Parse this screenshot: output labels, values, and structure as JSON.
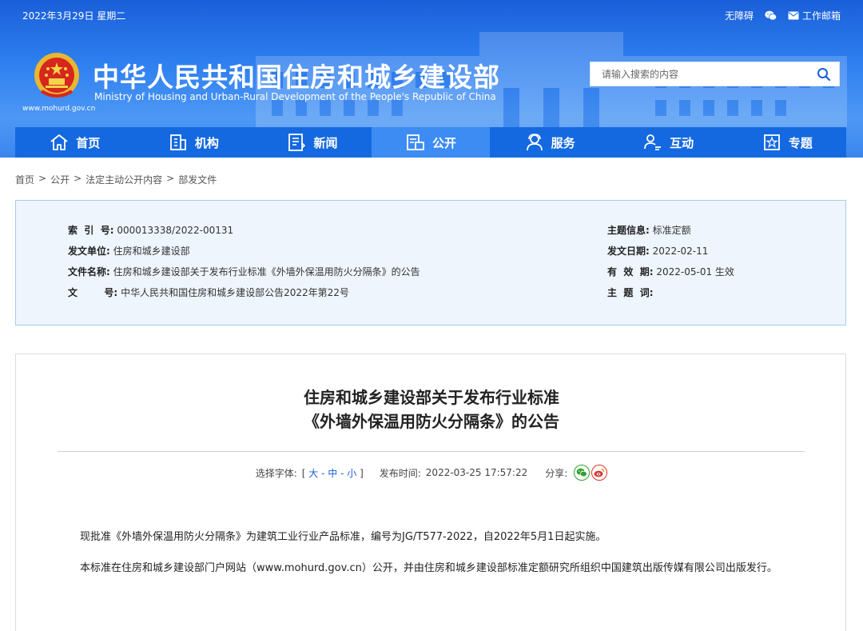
{
  "topbar": {
    "date": "2022年3月29日 星期二",
    "accessibility": "无障碍",
    "wechat_icon": "wechat-icon",
    "mail_label": "工作邮箱"
  },
  "header": {
    "title_cn": "中华人民共和国住房和城乡建设部",
    "title_en": "Ministry of Housing and Urban-Rural Development of the People's Republic of China",
    "site_url": "www.mohurd.gov.cn",
    "search_placeholder": "请输入搜索的内容",
    "colors": {
      "header_blue": "#2e7ff0",
      "nav_blue": "#1569e0",
      "nav_active": "#3d8cf3"
    }
  },
  "nav": {
    "items": [
      {
        "label": "首页",
        "icon": "home-icon"
      },
      {
        "label": "机构",
        "icon": "building-icon"
      },
      {
        "label": "新闻",
        "icon": "news-icon"
      },
      {
        "label": "公开",
        "icon": "disclosure-icon",
        "active": true
      },
      {
        "label": "服务",
        "icon": "service-icon"
      },
      {
        "label": "互动",
        "icon": "interaction-icon"
      },
      {
        "label": "专题",
        "icon": "topic-icon"
      }
    ]
  },
  "breadcrumb": {
    "items": [
      "首页",
      "公开",
      "法定主动公开内容",
      "部发文件"
    ],
    "separator": ">"
  },
  "info": {
    "index_label": "索  引  号:",
    "index_value": "000013338/2022-00131",
    "unit_label": "发文单位:",
    "unit_value": "住房和城乡建设部",
    "file_label": "文件名称:",
    "file_value": "住房和城乡建设部关于发布行业标准《外墙外保温用防火分隔条》的公告",
    "doc_label": "文        号:",
    "doc_value": "中华人民共和国住房和城乡建设部公告2022年第22号",
    "topic_label": "主题信息:",
    "topic_value": "标准定额",
    "date_label": "发文日期:",
    "date_value": "2022-02-11",
    "valid_label": "有  效  期:",
    "valid_value": "2022-05-01 生效",
    "keywords_label": "主  题  词:",
    "keywords_value": ""
  },
  "article": {
    "title_line1": "住房和城乡建设部关于发布行业标准",
    "title_line2": "《外墙外保温用防火分隔条》的公告",
    "font_size_label": "选择字体:",
    "font_large": "大",
    "font_medium": "中",
    "font_small": "小",
    "publish_label": "发布时间:",
    "publish_time": "2022-03-25 17:57:22",
    "share_label": "分享:",
    "paragraph1": "现批准《外墙外保温用防火分隔条》为建筑工业行业产品标准，编号为JG/T577-2022，自2022年5月1日起实施。",
    "paragraph2": "本标准在住房和城乡建设部门户网站（www.mohurd.gov.cn）公开，并由住房和城乡建设部标准定额研究所组织中国建筑出版传媒有限公司出版发行。"
  }
}
